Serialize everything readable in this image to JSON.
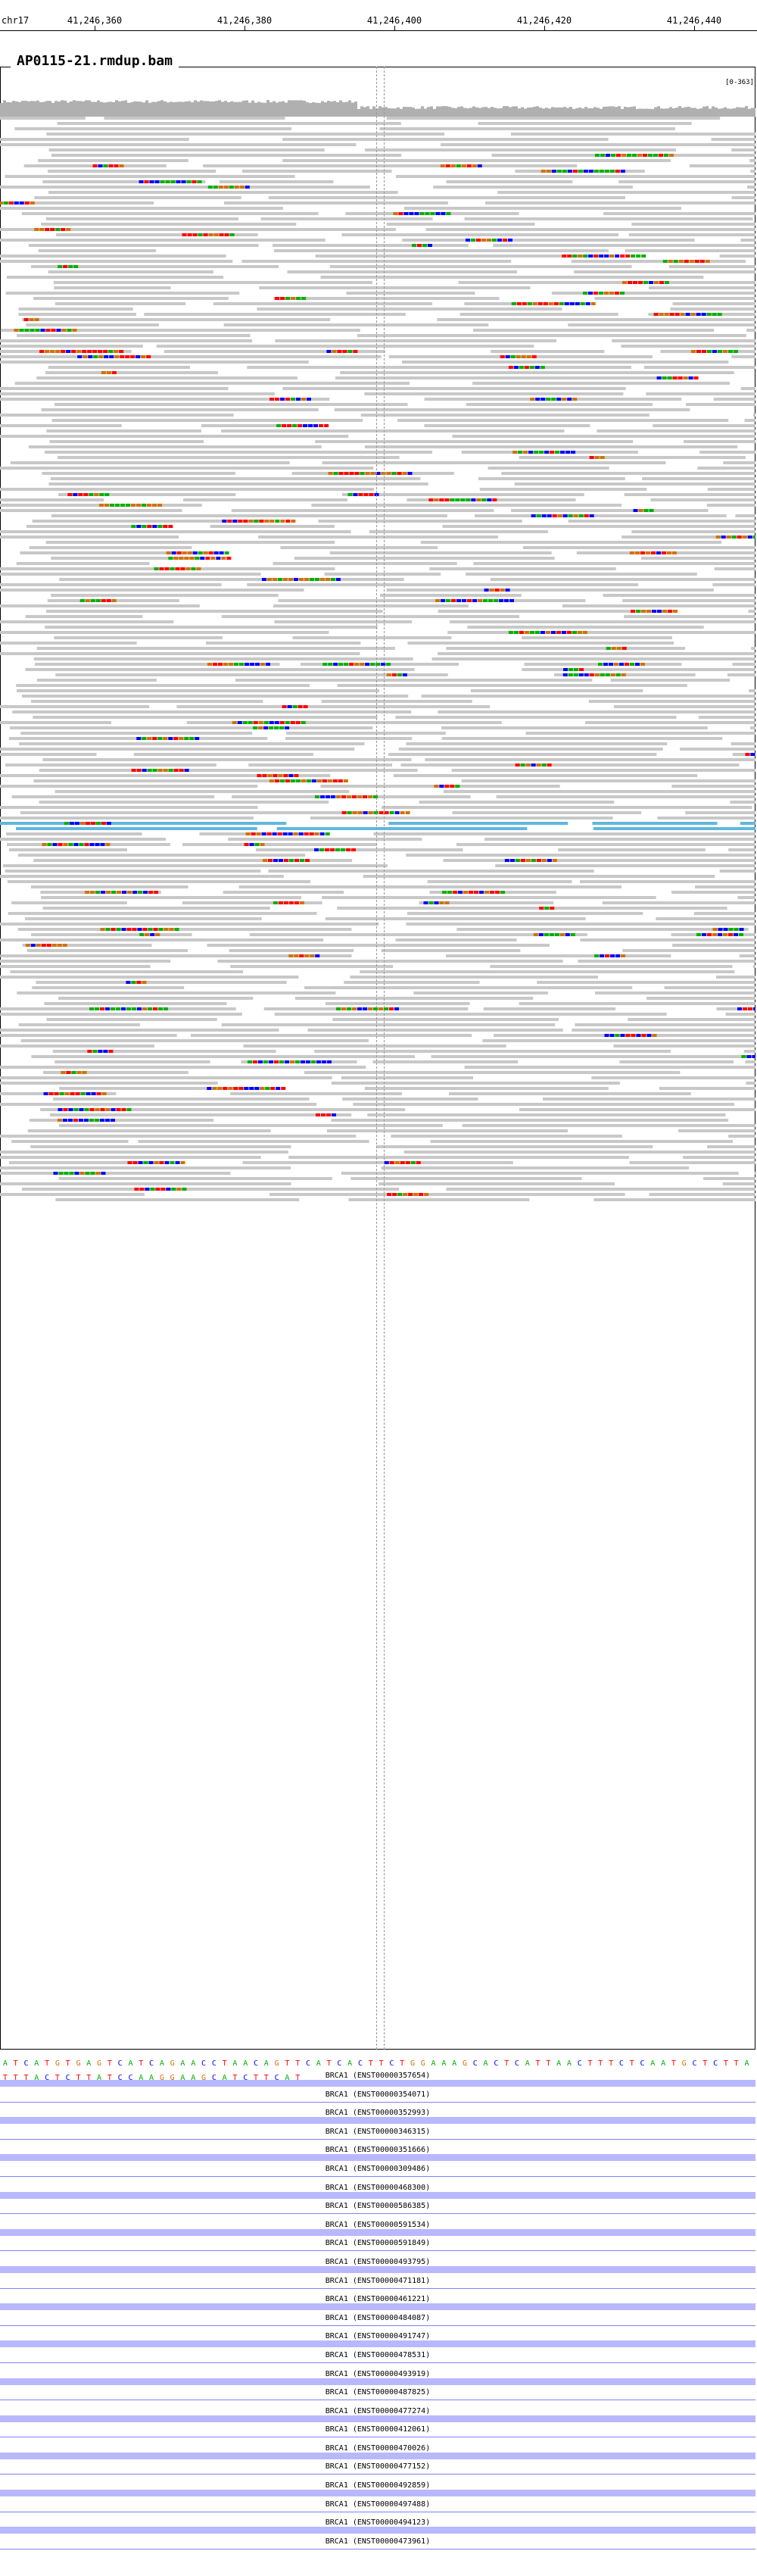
{
  "ruler": {
    "chromosome": "chr17",
    "ticks": [
      "41,246,360",
      "41,246,380",
      "41,246,400",
      "41,246,420",
      "41,246,440"
    ]
  },
  "track": {
    "name": "AP0115-21.rmdup.bam",
    "data_range": "[0-363]"
  },
  "sequence": "ATCATGTGAGTCATCAGAACCTAACAGTTCATCACTTCTGGAAAGCACTCATTAACTTTCTCAATGCTCTTATTTACTCTTATCCAAGGAAGCATCTTCAT",
  "base_colors": {
    "A": "#00b000",
    "C": "#0000ff",
    "G": "#d17105",
    "T": "#ff0000"
  },
  "read_color": "#c8c8c8",
  "softclip_color": "#5fb7e0",
  "genes": [
    {
      "label": "BRCA1 (ENST00000357654)"
    },
    {
      "label": "BRCA1 (ENST00000354071)"
    },
    {
      "label": "BRCA1 (ENST00000352993)"
    },
    {
      "label": "BRCA1 (ENST00000346315)"
    },
    {
      "label": "BRCA1 (ENST00000351666)"
    },
    {
      "label": "BRCA1 (ENST00000309486)"
    },
    {
      "label": "BRCA1 (ENST00000468300)"
    },
    {
      "label": "BRCA1 (ENST00000586385)"
    },
    {
      "label": "BRCA1 (ENST00000591534)"
    },
    {
      "label": "BRCA1 (ENST00000591849)"
    },
    {
      "label": "BRCA1 (ENST00000493795)"
    },
    {
      "label": "BRCA1 (ENST00000471181)"
    },
    {
      "label": "BRCA1 (ENST00000461221)"
    },
    {
      "label": "BRCA1 (ENST00000484087)"
    },
    {
      "label": "BRCA1 (ENST00000491747)"
    },
    {
      "label": "BRCA1 (ENST00000478531)"
    },
    {
      "label": "BRCA1 (ENST00000493919)"
    },
    {
      "label": "BRCA1 (ENST00000487825)"
    },
    {
      "label": "BRCA1 (ENST00000477274)"
    },
    {
      "label": "BRCA1 (ENST00000412061)"
    },
    {
      "label": "BRCA1 (ENST00000470026)"
    },
    {
      "label": "BRCA1 (ENST00000477152)"
    },
    {
      "label": "BRCA1 (ENST00000492859)"
    },
    {
      "label": "BRCA1 (ENST00000497488)"
    },
    {
      "label": "BRCA1 (ENST00000494123)"
    },
    {
      "label": "BRCA1 (ENST00000473961)"
    }
  ]
}
